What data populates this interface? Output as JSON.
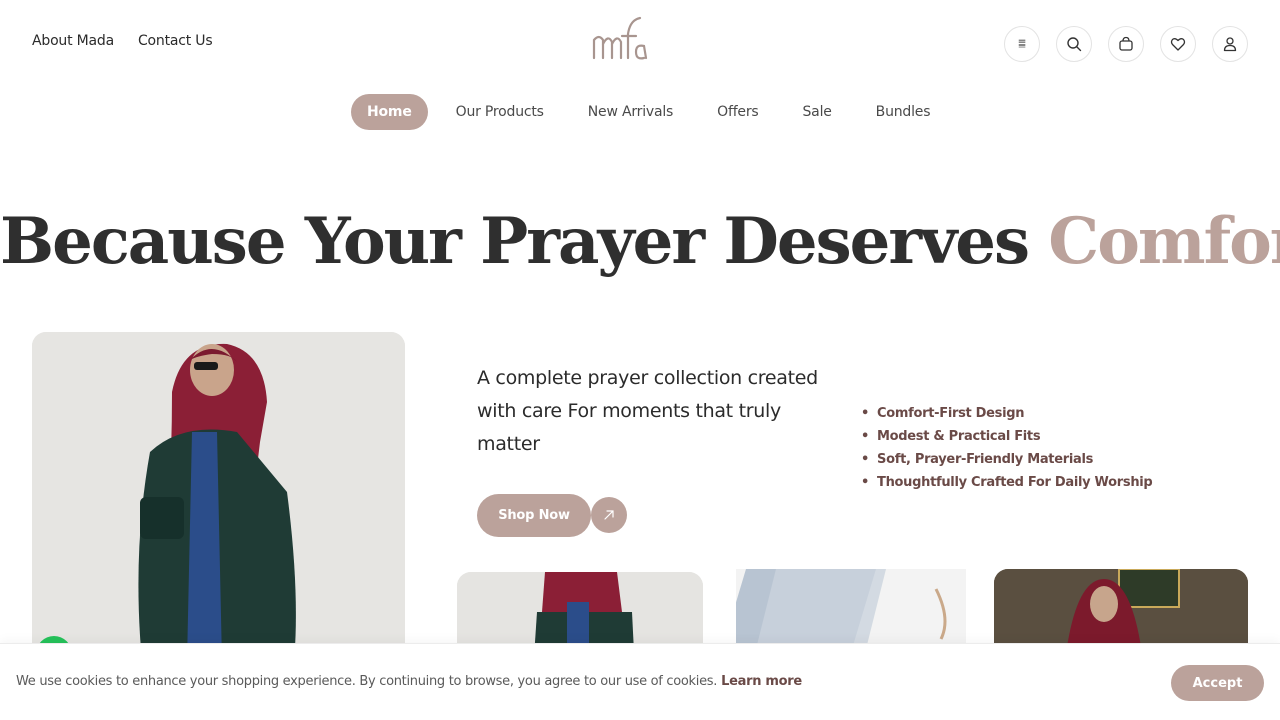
{
  "header": {
    "links": [
      "About Mada",
      "Contact Us"
    ],
    "logo_text": "mada",
    "icons": [
      "language-icon",
      "search-icon",
      "cart-icon",
      "heart-icon",
      "user-icon"
    ],
    "lang_glyph": "䷀"
  },
  "nav": {
    "items": [
      {
        "label": "Home",
        "active": true
      },
      {
        "label": "Our Products"
      },
      {
        "label": "New Arrivals"
      },
      {
        "label": "Offers"
      },
      {
        "label": "Sale"
      },
      {
        "label": "Bundles"
      }
    ]
  },
  "hero": {
    "headline_main": "Because Your Prayer Deserves ",
    "headline_accent": "Comfort",
    "tagline": "A complete prayer collection created with care For moments that truly matter",
    "features": [
      "Comfort-First Design",
      "Modest & Practical Fits",
      "Soft, Prayer-Friendly Materials",
      "Thoughtfully Crafted For Daily Worship"
    ],
    "cta_label": "Shop Now"
  },
  "cookie": {
    "text": "We use cookies to enhance your shopping experience. By continuing to browse, you agree to our use of cookies.",
    "link": "Learn more",
    "accept_label": "Accept"
  },
  "colors": {
    "accent": "#bba29b",
    "dark": "#2f2f2f",
    "feature_text": "#6a4a47"
  }
}
